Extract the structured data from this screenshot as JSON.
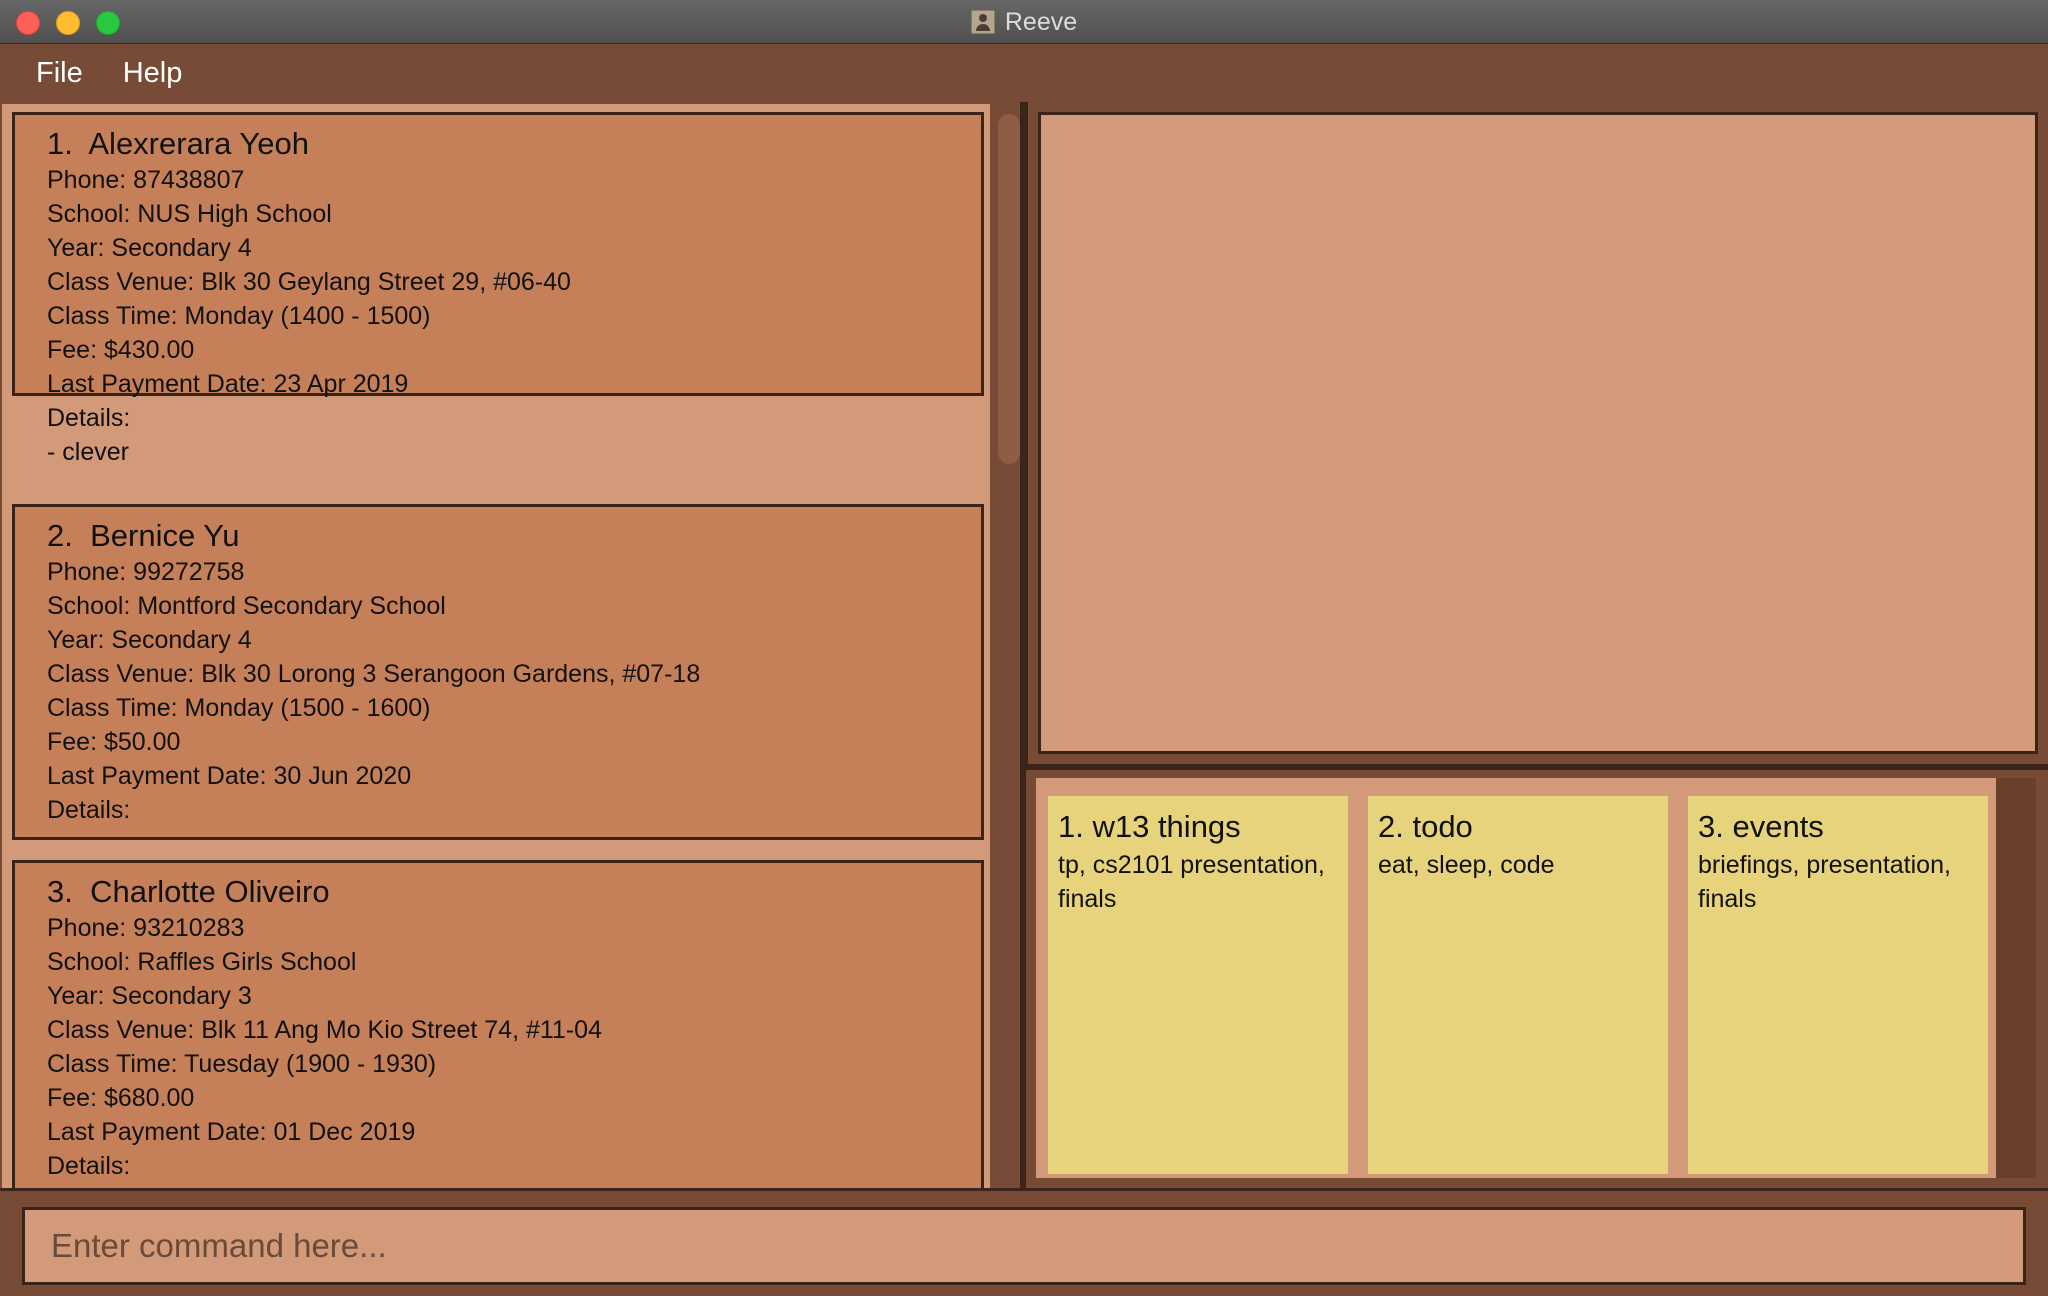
{
  "window": {
    "title": "Reeve",
    "icon": "contacts-icon"
  },
  "menu": {
    "items": [
      "File",
      "Help"
    ]
  },
  "students": [
    {
      "index": "1.",
      "name": "Alexrerara Yeoh",
      "lines": [
        "Phone: 87438807",
        "School: NUS High School",
        "Year: Secondary 4",
        "Class Venue: Blk 30 Geylang Street 29, #06-40",
        "Class Time: Monday (1400 - 1500)",
        "Fee: $430.00",
        "Last Payment Date: 23 Apr 2019",
        "Details:",
        "- clever"
      ]
    },
    {
      "index": "2.",
      "name": "Bernice Yu",
      "lines": [
        "Phone: 99272758",
        "School: Montford Secondary School",
        "Year: Secondary 4",
        "Class Venue: Blk 30 Lorong 3 Serangoon Gardens, #07-18",
        "Class Time: Monday (1500 - 1600)",
        "Fee: $50.00",
        "Last Payment Date: 30 Jun 2020",
        "Details:"
      ]
    },
    {
      "index": "3.",
      "name": "Charlotte Oliveiro",
      "lines": [
        "Phone: 93210283",
        "School: Raffles Girls School",
        "Year: Secondary 3",
        "Class Venue: Blk 11 Ang Mo Kio Street 74, #11-04",
        "Class Time: Tuesday (1900 - 1930)",
        "Fee: $680.00",
        "Last Payment Date: 01 Dec 2019",
        "Details:"
      ]
    }
  ],
  "notes": [
    {
      "title": "1. w13 things",
      "body_lines": [
        "tp, cs2101 presentation,",
        "finals"
      ]
    },
    {
      "title": "2. todo",
      "body_lines": [
        "eat, sleep, code"
      ]
    },
    {
      "title": "3. events",
      "body_lines": [
        "briefings, presentation,",
        "finals"
      ]
    }
  ],
  "command": {
    "placeholder": "Enter command here...",
    "value": ""
  },
  "colors": {
    "frame": "#774b35",
    "panel": "#d39a79",
    "card": "#c58059",
    "note": "#e6d37c",
    "border": "#3a2318"
  }
}
